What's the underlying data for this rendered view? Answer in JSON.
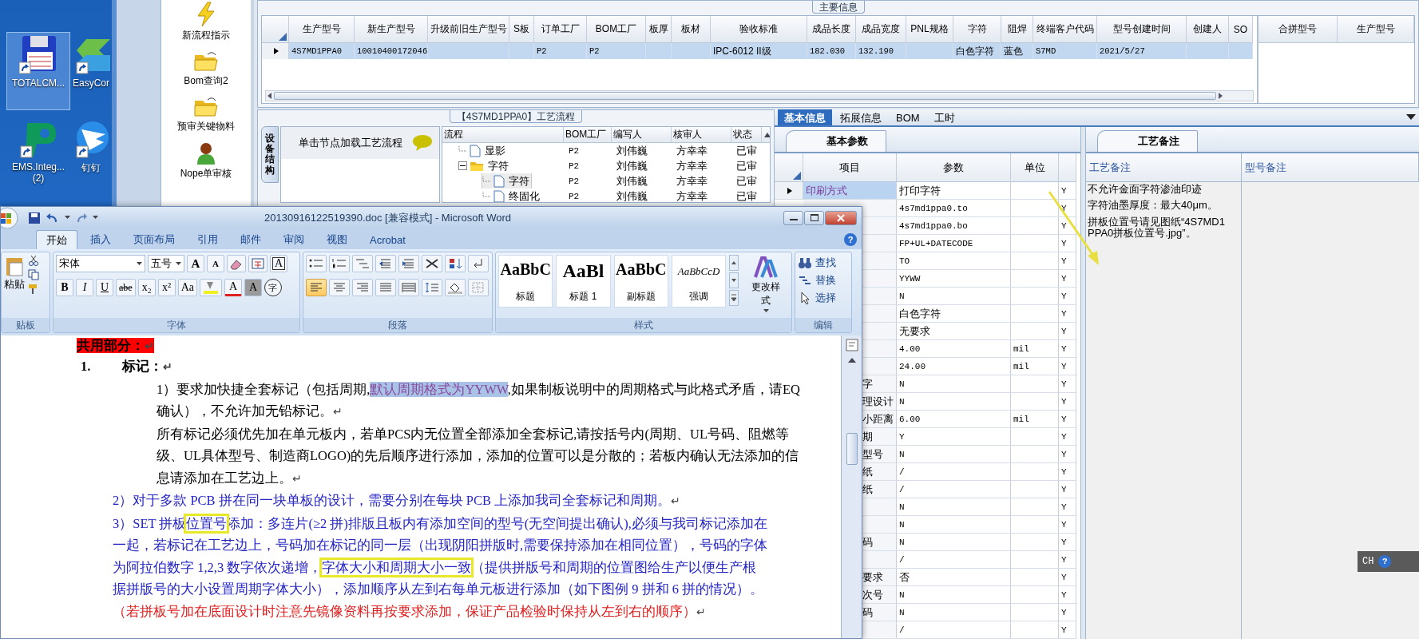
{
  "desktop": {
    "icons": [
      {
        "label": "TOTALCM...",
        "kind": "floppy",
        "selected": true
      },
      {
        "label": "EasyCor",
        "kind": "chevrons",
        "selected": false
      },
      {
        "label": "EMS.Integ...\n(2)",
        "kind": "logo",
        "selected": false
      },
      {
        "label": "钉钉",
        "kind": "wing",
        "selected": false
      }
    ]
  },
  "nav": {
    "items": [
      {
        "label": "新流程指示",
        "kind": "lightning"
      },
      {
        "label": "Bom查询2",
        "kind": "folder"
      },
      {
        "label": "预审关键物料",
        "kind": "folder"
      },
      {
        "label": "Nope单审核",
        "kind": "person"
      }
    ]
  },
  "main_info": {
    "title": "主要信息",
    "columns": [
      "生产型号",
      "新生产型号",
      "升级前旧生产型号",
      "S板",
      "订单工厂",
      "BOM工厂",
      "板厚",
      "板材",
      "验收标准",
      "成品长度",
      "成品宽度",
      "PNL规格",
      "字符",
      "阻焊",
      "终端客户代码",
      "型号创建时间",
      "创建人",
      "SO"
    ],
    "rows": [
      {
        "selected": true,
        "cells": [
          "4S7MD1PPA0",
          "10010400172046",
          "",
          "",
          "P2",
          "P2",
          "",
          "",
          "IPC-6012 II级",
          "182.030",
          "132.190",
          "",
          "白色字符",
          "蓝色",
          "S7MD",
          "2021/5/27",
          "",
          ""
        ]
      }
    ],
    "merge_columns": [
      "合拼型号",
      "生产型号"
    ]
  },
  "process_flow": {
    "title": "【4S7MD1PPA0】工艺流程",
    "side_tab": "设备结构",
    "hint": "单击节点加载工艺流程",
    "columns": [
      "流程",
      "BOM工厂",
      "编写人",
      "核审人",
      "状态"
    ],
    "rows": [
      {
        "name": "显影",
        "kind": "document",
        "selected": false,
        "bom_factory": "P2",
        "writer": "刘伟巍",
        "reviewer": "方幸幸",
        "status": "已审"
      },
      {
        "name": "字符",
        "kind": "folder",
        "selected": false,
        "expanded": true,
        "bom_factory": "P2",
        "writer": "刘伟巍",
        "reviewer": "方幸幸",
        "status": "已审",
        "children": [
          {
            "name": "字符",
            "kind": "document",
            "selected": true,
            "bom_factory": "P2",
            "writer": "刘伟巍",
            "reviewer": "方幸幸",
            "status": "已审"
          },
          {
            "name": "终固化",
            "kind": "document",
            "selected": false,
            "bom_factory": "P2",
            "writer": "刘伟巍",
            "reviewer": "方幸幸",
            "status": "已审"
          }
        ]
      }
    ]
  },
  "detail": {
    "tabs": [
      {
        "label": "基本信息",
        "selected": true
      },
      {
        "label": "拓展信息",
        "selected": false
      },
      {
        "label": "BOM",
        "selected": false
      },
      {
        "label": "工时",
        "selected": false
      }
    ],
    "params": {
      "tab": "基本参数",
      "columns": [
        "项目",
        "参数",
        "单位"
      ],
      "rows": [
        {
          "item": "印刷方式",
          "value": "打印字符",
          "flag": "Y",
          "selected": true
        },
        {
          "value": "4s7md1ppa0.to",
          "flag": "Y",
          "selected": false
        },
        {
          "value": "4s7md1ppa0.bo",
          "flag": "Y",
          "selected": false
        },
        {
          "value": "FP+UL+DATECODE",
          "flag": "Y",
          "selected": false
        },
        {
          "value": "TO",
          "flag": "Y",
          "selected": false
        },
        {
          "value": "YYWW",
          "flag": "Y",
          "selected": false
        },
        {
          "value": "N",
          "flag": "Y",
          "selected": false
        },
        {
          "value": "白色字符",
          "flag": "Y",
          "selected": false
        },
        {
          "value": "无要求",
          "flag": "Y",
          "selected": false
        },
        {
          "value": "4.00",
          "unit": "mil",
          "flag": "Y",
          "selected": false
        },
        {
          "value": "24.00",
          "unit": "mil",
          "flag": "Y",
          "selected": false
        },
        {
          "item": "字",
          "value": "N",
          "flag": "Y",
          "selected": false
        },
        {
          "item": "理设计",
          "value": "N",
          "flag": "Y",
          "selected": false
        },
        {
          "item": "小距离",
          "value": "6.00",
          "unit": "mil",
          "flag": "Y",
          "selected": false
        },
        {
          "item": "期",
          "value": "Y",
          "flag": "Y",
          "selected": false
        },
        {
          "item": "型号",
          "value": "N",
          "flag": "Y",
          "selected": false
        },
        {
          "item": "纸",
          "value": "/",
          "flag": "Y",
          "selected": false
        },
        {
          "item": "纸",
          "value": "/",
          "flag": "Y",
          "selected": false
        },
        {
          "value": "N",
          "flag": "Y",
          "selected": false
        },
        {
          "value": "N",
          "flag": "Y",
          "selected": false
        },
        {
          "item": "码",
          "value": "N",
          "flag": "Y",
          "selected": false
        },
        {
          "value": "/",
          "flag": "Y",
          "selected": false
        },
        {
          "item": "要求",
          "value": "否",
          "flag": "Y",
          "selected": false
        },
        {
          "item": "次号",
          "value": "N",
          "flag": "Y",
          "selected": false
        },
        {
          "item": "码",
          "value": "N",
          "flag": "Y",
          "selected": false
        },
        {
          "value": "/",
          "flag": "Y",
          "selected": false
        }
      ]
    },
    "notes": {
      "tab": "工艺备注",
      "columns": [
        "工艺备注",
        "型号备注"
      ],
      "lines": [
        "不允许金面字符渗油印迹",
        "字符油墨厚度：最大40μm。",
        "拼板位置号请见图纸“4S7MD1PPA0拼板位置号.jpg”。"
      ]
    }
  },
  "word": {
    "title": "20130916122519390.doc [兼容模式] - Microsoft Word",
    "tabs": [
      {
        "label": "开始",
        "selected": true
      },
      {
        "label": "插入",
        "selected": false
      },
      {
        "label": "页面布局",
        "selected": false
      },
      {
        "label": "引用",
        "selected": false
      },
      {
        "label": "邮件",
        "selected": false
      },
      {
        "label": "审阅",
        "selected": false
      },
      {
        "label": "视图",
        "selected": false
      },
      {
        "label": "Acrobat",
        "selected": false
      }
    ],
    "help": "?",
    "clipboard": {
      "label": "贴板",
      "paste": "粘贴"
    },
    "font": {
      "label": "字体",
      "name": "宋体",
      "size": "五号",
      "row1": [
        {
          "kind": "grow",
          "label": "A"
        },
        {
          "kind": "shrink",
          "label": "A"
        },
        {
          "kind": "clear-format"
        },
        {
          "kind": "phonetic"
        },
        {
          "kind": "border",
          "label": "A"
        }
      ],
      "row2": [
        {
          "kind": "bold",
          "label": "B"
        },
        {
          "kind": "italic",
          "label": "I"
        },
        {
          "kind": "underline",
          "label": "U"
        },
        {
          "kind": "strike",
          "label": "abe"
        },
        {
          "kind": "plain",
          "label": "x₂"
        },
        {
          "kind": "plain",
          "label": "x²"
        },
        {
          "kind": "plain",
          "label": "Aa"
        },
        {
          "kind": "highlight"
        },
        {
          "kind": "color",
          "label": "A"
        },
        {
          "kind": "shade",
          "label": "A"
        },
        {
          "kind": "enclose",
          "label": "字"
        }
      ]
    },
    "paragraph": {
      "label": "段落",
      "align": [
        {
          "selected": true
        },
        {
          "selected": false
        },
        {
          "selected": false
        },
        {
          "selected": false
        },
        {
          "selected": false
        }
      ]
    },
    "styles": {
      "label": "样式",
      "change": "更改样式",
      "items": [
        {
          "sample": "AaBbC",
          "name": "标题",
          "kind": "normal"
        },
        {
          "sample": "AaBl",
          "name": "标题 1",
          "kind": "big"
        },
        {
          "sample": "AaBbC",
          "name": "副标题",
          "kind": "normal"
        },
        {
          "sample": "AaBbCcD",
          "name": "强调",
          "kind": "italic"
        }
      ]
    },
    "editing": {
      "label": "编辑",
      "items": [
        {
          "label": "查找",
          "kind": "find"
        },
        {
          "label": "替换",
          "kind": "replace"
        },
        {
          "label": "选择",
          "kind": "select"
        }
      ]
    },
    "paragraphs": [
      {
        "kind": "banner",
        "lines": [
          [
            {
              "text": "共用部分：",
              "kind": "plain"
            },
            {
              "text": "↵",
              "kind": "mark"
            }
          ]
        ]
      },
      {
        "kind": "heading",
        "number": "1.",
        "lines": [
          [
            {
              "text": "标记：",
              "kind": "plain"
            },
            {
              "text": "↵",
              "kind": "mark"
            }
          ]
        ]
      },
      {
        "kind": "indent",
        "color": "#000000",
        "lines": [
          [
            {
              "text": "1）要求加快捷全套标记（包括周期,",
              "kind": "plain"
            },
            {
              "text": "默认周期格式为YYWW",
              "kind": "selected"
            },
            {
              "text": ",如果制板说明中的周期格式与此格式矛盾，请EQ",
              "kind": "plain"
            }
          ],
          [
            {
              "text": "确认），不允许加无铅标记。",
              "kind": "plain"
            },
            {
              "text": "↵",
              "kind": "mark"
            }
          ]
        ]
      },
      {
        "kind": "indent",
        "color": "#000000",
        "lines": [
          [
            {
              "text": "所有标记必须优先加在单元板内，若单PCS内无位置全部添加全套标记,请按括号内(周期、UL号码、阻燃等",
              "kind": "plain"
            }
          ],
          [
            {
              "text": "级、UL具体型号、制造商LOGO)的先后顺序进行添加，添加的位置可以是分散的；若板内确认无法添加的信",
              "kind": "plain"
            }
          ],
          [
            {
              "text": "息请添加在工艺边上。",
              "kind": "plain"
            },
            {
              "text": "↵",
              "kind": "mark"
            }
          ]
        ]
      },
      {
        "kind": "outdent",
        "color": "#2424c4",
        "lines": [
          [
            {
              "text": "2）对于多款 PCB 拼在同一块单板的设计，需要分别在每块 PCB 上添加我司全套标记和周期。",
              "kind": "plain"
            },
            {
              "text": "↵",
              "kind": "mark"
            }
          ]
        ]
      },
      {
        "kind": "outdent",
        "color": "#2424c4",
        "lines": [
          [
            {
              "text": "3）SET 拼板",
              "kind": "plain"
            },
            {
              "text": "位置号",
              "kind": "boxed"
            },
            {
              "text": "添加：多连片(≥2 拼)排版且板内有添加空间的型号(无空间提出确认),必须与我司标记添加在",
              "kind": "plain"
            }
          ],
          [
            {
              "text": "一起，若标记在工艺边上，号码加在标记的同一层（出现阴阳拼版时,需要保持添加在相同位置），号码的字体",
              "kind": "plain"
            }
          ],
          [
            {
              "text": "为阿拉伯数字  1,2,3  数字依次递增，",
              "kind": "plain"
            },
            {
              "text": "字体大小和周期大小一致",
              "kind": "boxed"
            },
            {
              "text": "（提供拼版号和周期的位置图给生产以便生产根",
              "kind": "plain"
            }
          ],
          [
            {
              "text": "据拼版号的大小设置周期字体大小），添加顺序从左到右每单元板进行添加（如下图例 9 拼和 6 拼的情况）。",
              "kind": "plain"
            }
          ]
        ]
      },
      {
        "kind": "outdent",
        "color": "#e02020",
        "lines": [
          [
            {
              "text": "（若拼板号加在底面设计时注意先镜像资料再按要求添加，保证产品检验时保持从左到右的顺序）",
              "kind": "plain"
            },
            {
              "text": "↵",
              "kind": "mark"
            }
          ]
        ]
      }
    ]
  },
  "language_bar": {
    "label": "CH",
    "help": "?"
  }
}
